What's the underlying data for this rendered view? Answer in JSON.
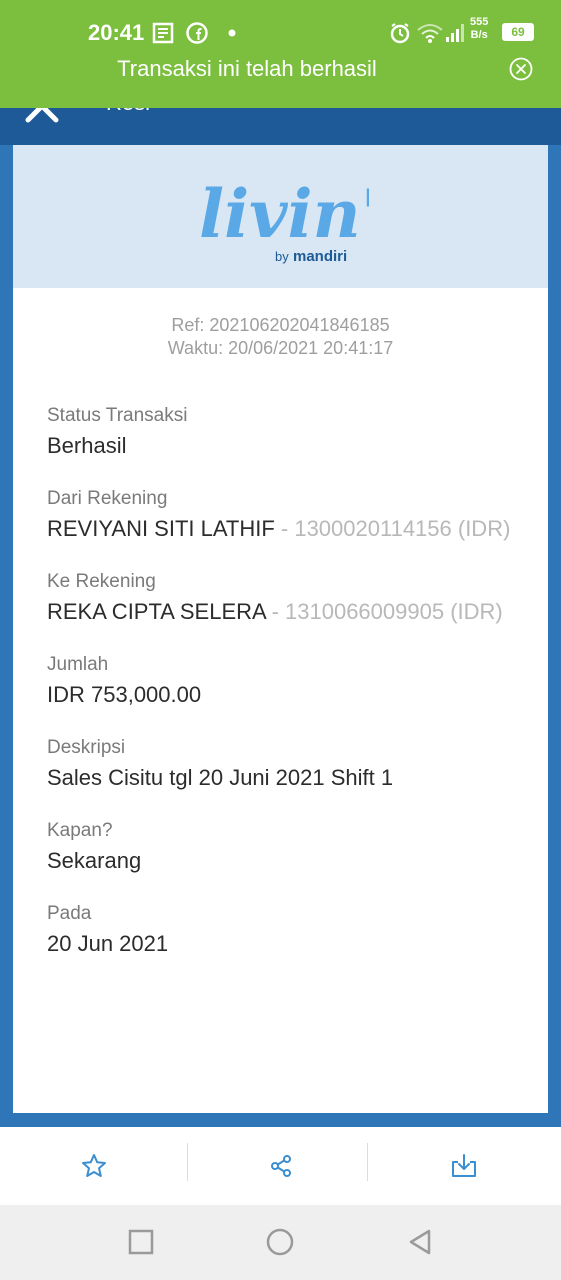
{
  "statusbar": {
    "time": "20:41",
    "net_speed_value": "555",
    "net_speed_unit": "B/s",
    "battery": "69"
  },
  "toast": {
    "message": "Transaksi ini telah berhasil"
  },
  "header": {
    "title": "Resi"
  },
  "logo": {
    "brand": "livin'",
    "by": "by",
    "company": "mandiri"
  },
  "receipt": {
    "ref": "Ref: 202106202041846185",
    "time": "Waktu: 20/06/2021 20:41:17",
    "fields": [
      {
        "label": "Status Transaksi",
        "value": "Berhasil"
      },
      {
        "label": "Dari Rekening",
        "value": "REVIYANI SITI LATHIF",
        "sub": " - 1300020114156 (IDR)"
      },
      {
        "label": "Ke Rekening",
        "value": "REKA CIPTA SELERA",
        "sub": " - 1310066009905 (IDR)"
      },
      {
        "label": "Jumlah",
        "value": "IDR 753,000.00"
      },
      {
        "label": "Deskripsi",
        "value": "Sales Cisitu tgl 20 Juni 2021 Shift 1"
      },
      {
        "label": "Kapan?",
        "value": "Sekarang"
      },
      {
        "label": "Pada",
        "value": "20 Jun 2021"
      }
    ]
  },
  "colors": {
    "toast_green": "#7cbf3f",
    "header_blue": "#1d5a97",
    "background_blue": "#2e76b8",
    "logo_blue": "#5aa9e6",
    "icon_blue": "#3b8ed0"
  }
}
